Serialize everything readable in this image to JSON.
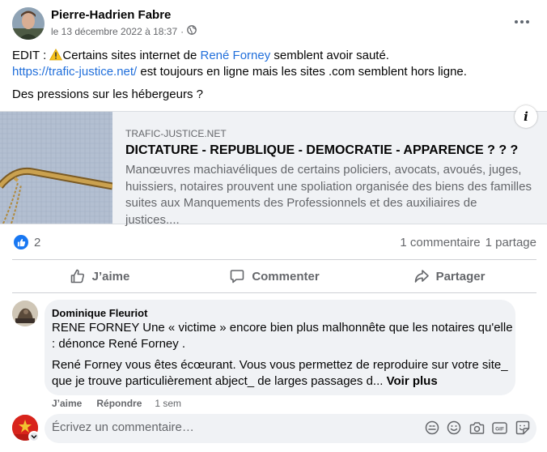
{
  "post": {
    "author": "Pierre-Hadrien Fabre",
    "timestamp": "le 13 décembre 2022 à 18:37",
    "separator": "·",
    "audience_icon": "globe-icon",
    "text": {
      "edit_prefix": "EDIT : ",
      "warning_icon": "⚠️",
      "line1_a": "Certains sites internet de ",
      "line1_link": "René Forney",
      "line1_b": " semblent avoir sauté.",
      "line2_link": "https://trafic-justice.net/",
      "line2_b": " est toujours en ligne mais les sites .com semblent hors ligne.",
      "line3": "Des pressions sur les hébergeurs ?"
    }
  },
  "link_preview": {
    "domain": "TRAFIC-JUSTICE.NET",
    "title": "DICTATURE - REPUBLIQUE - DEMOCRATIE - APPARENCE ? ? ?",
    "description": "Manœuvres machiavéliques de certains policiers, avocats, avoués, juges, huissiers, notaires prouvent une spoliation organisée des biens des familles suites aux Manquements des Professionnels et des auxiliaires de justices....",
    "info_label": "i"
  },
  "stats": {
    "likes": "2",
    "comments": "1 commentaire",
    "shares": "1 partage"
  },
  "actions": {
    "like": "J’aime",
    "comment": "Commenter",
    "share": "Partager"
  },
  "comment": {
    "author": "Dominique Fleuriot",
    "line1": "RENE FORNEY Une « victime » encore bien plus malhonnête que les notaires qu'elle",
    "line2": ": dénonce René Forney .",
    "line3": "René Forney vous êtes écœurant. Vous vous permettez de reproduire sur votre site_",
    "line4": "que je trouve particulièrement abject_ de larges passages d...",
    "see_more": "Voir plus",
    "like": "J’aime",
    "reply": "Répondre",
    "time": "1 sem"
  },
  "composer": {
    "placeholder": "Écrivez un commentaire…",
    "icons": [
      "sticker-avatar-icon",
      "emoji-icon",
      "camera-icon",
      "gif-icon",
      "sticker-icon"
    ]
  },
  "colors": {
    "link": "#216fdb",
    "like_blue": "#1877f2",
    "secondary_text": "#65676b",
    "bubble_bg": "#f0f2f5"
  }
}
